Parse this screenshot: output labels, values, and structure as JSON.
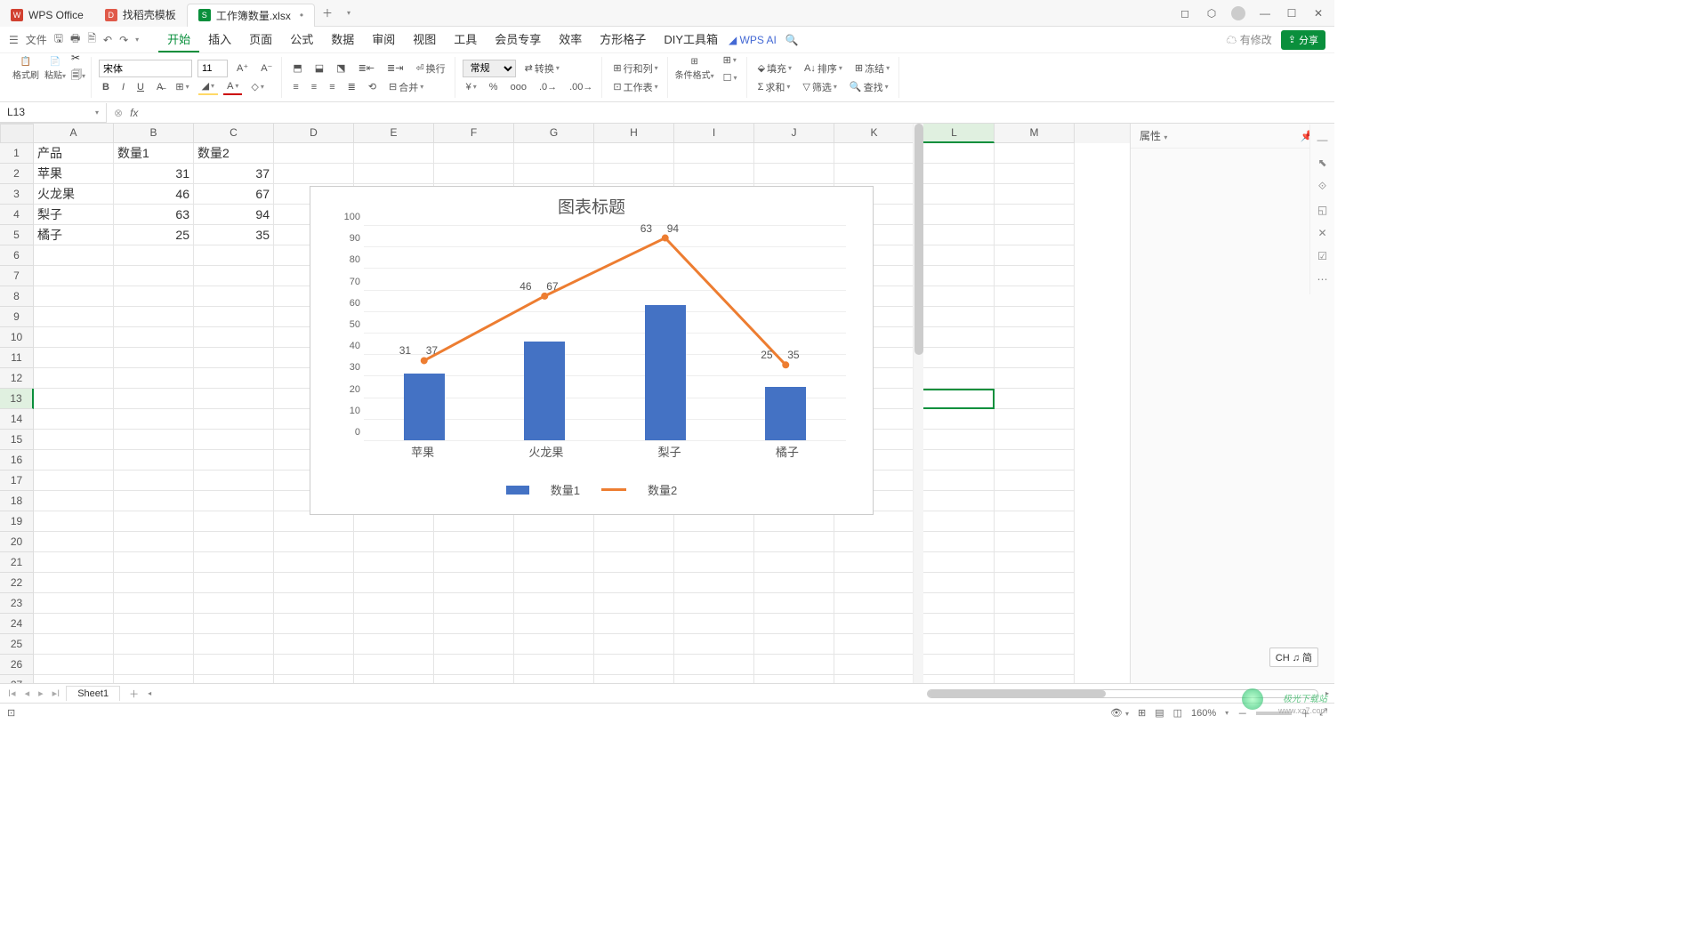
{
  "title_tabs": [
    {
      "icon_class": "icon-wps",
      "icon_text": "W",
      "label": "WPS Office"
    },
    {
      "icon_class": "icon-template",
      "icon_text": "D",
      "label": "找稻壳模板"
    },
    {
      "icon_class": "icon-sheet",
      "icon_text": "S",
      "label": "工作簿数量.xlsx",
      "dirty": "•",
      "active": true
    }
  ],
  "menu": {
    "file": "文件",
    "items": [
      "开始",
      "插入",
      "页面",
      "公式",
      "数据",
      "审阅",
      "视图",
      "工具",
      "会员专享",
      "效率",
      "方形格子",
      "DIY工具箱"
    ],
    "active": "开始",
    "wps_ai": "WPS AI",
    "mod_label": "有修改",
    "share": "分享"
  },
  "ribbon": {
    "brush": "格式刷",
    "paste": "粘贴",
    "font_name": "宋体",
    "font_size": "11",
    "wrap": "换行",
    "merge": "合并",
    "general": "常规",
    "convert": "转换",
    "rowcol": "行和列",
    "worksheet": "工作表",
    "cond_fmt": "条件格式",
    "fill": "填充",
    "sort": "排序",
    "freeze": "冻结",
    "sum": "求和",
    "filter": "筛选",
    "find": "查找"
  },
  "cell_ref": "L13",
  "fx": "fx",
  "columns": [
    "A",
    "B",
    "C",
    "D",
    "E",
    "F",
    "G",
    "H",
    "I",
    "J",
    "K",
    "L",
    "M"
  ],
  "selected_col": "L",
  "selected_row": 13,
  "row_count": 27,
  "sheet_data": {
    "1": {
      "A": "产品",
      "B": "数量1",
      "C": "数量2"
    },
    "2": {
      "A": "苹果",
      "B": "31",
      "C": "37"
    },
    "3": {
      "A": "火龙果",
      "B": "46",
      "C": "67"
    },
    "4": {
      "A": "梨子",
      "B": "63",
      "C": "94"
    },
    "5": {
      "A": "橘子",
      "B": "25",
      "C": "35"
    }
  },
  "chart_data": {
    "type": "bar+line",
    "title": "图表标题",
    "categories": [
      "苹果",
      "火龙果",
      "梨子",
      "橘子"
    ],
    "series": [
      {
        "name": "数量1",
        "type": "bar",
        "values": [
          31,
          46,
          63,
          25
        ],
        "color": "#4472c4"
      },
      {
        "name": "数量2",
        "type": "line",
        "values": [
          37,
          67,
          94,
          35
        ],
        "color": "#ed7d31"
      }
    ],
    "ylim": [
      0,
      100
    ],
    "yticks": [
      0,
      10,
      20,
      30,
      40,
      50,
      60,
      70,
      80,
      90,
      100
    ]
  },
  "panel": {
    "title": "属性"
  },
  "sheet_tab": "Sheet1",
  "status": {
    "zoom": "160%",
    "ime": "CH ♫ 简"
  },
  "watermark": "极光下载站",
  "watermark_url": "www.xz7.com"
}
